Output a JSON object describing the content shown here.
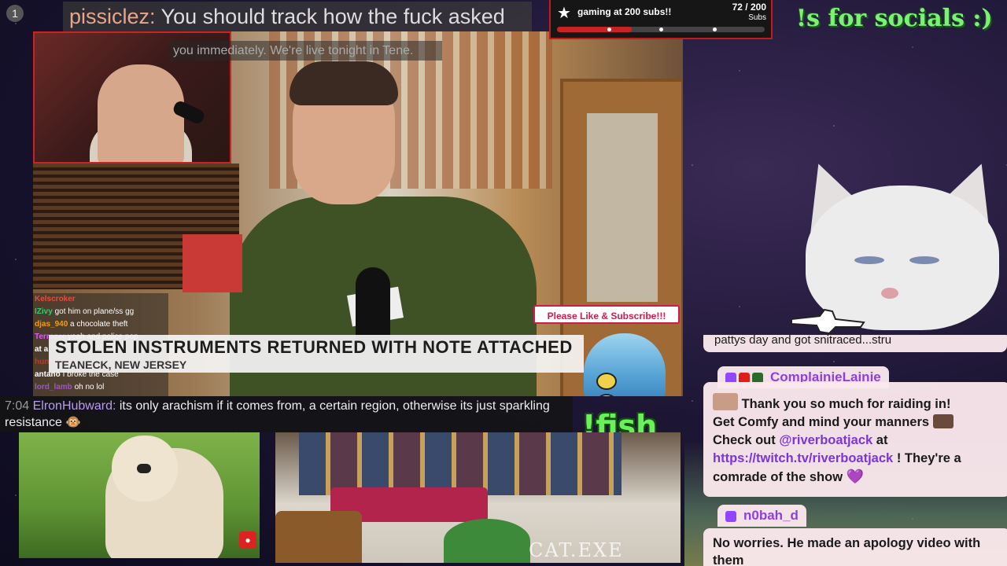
{
  "top_chat": {
    "badge": "1",
    "username": "pissiclez:",
    "message": "You should track how the fuck asked"
  },
  "sub_goal": {
    "icon": "star-icon",
    "title": "gaming at 200 subs!!",
    "count_text": "72 / 200",
    "label": "Subs",
    "progress": 0.36
  },
  "socials_text": "!s for socials :)",
  "main_video": {
    "captions": "you immediately. We're live tonight in Tene.",
    "headline": "STOLEN INSTRUMENTS RETURNED WITH NOTE ATTACHED",
    "location": "TEANECK, NEW JERSEY",
    "subscribe_label": "Please Like & Subscribe!!!"
  },
  "mini_chat": [
    {
      "user": "Kelscroker",
      "msg": "",
      "color": "#e74c3c"
    },
    {
      "user": "IZivy",
      "msg": "got him on plane/ss gg",
      "color": "#2ecc71"
    },
    {
      "user": "djas_940",
      "msg": "a chocolate theft",
      "color": "#f39c12"
    },
    {
      "user": "Terrozer",
      "msg": "yeah and police pop",
      "color": "#e056fd"
    },
    {
      "user": "at a",
      "msg": "",
      "color": "#ffffff"
    },
    {
      "user": "huntersbane",
      "msg": "",
      "color": "#c0392b"
    },
    {
      "user": "antano",
      "msg": "I broke the case",
      "color": "#ffffff"
    },
    {
      "user": "lord_lamb",
      "msg": "oh no lol",
      "color": "#9b59b6"
    }
  ],
  "bottom_chat": {
    "time": "7:04",
    "username": "ElronHubward:",
    "message": "its only arachism if it comes from, a certain region, otherwise its just sparkling resistance 🐵"
  },
  "fish_command": "!fish",
  "cat_cam_label": "CAT.EXE",
  "side_chat": {
    "prev_text": "pattys day and got snitraced...stru",
    "msg1": {
      "username": "ComplainieLainie",
      "text_a": "Thank you so much for raiding in!",
      "text_b": "Get Comfy and mind your manners",
      "text_c": "Check out",
      "mention": "@riverboatjack",
      "text_d": "at",
      "link": "https://twitch.tv/riverboatjack",
      "text_e": "! They're a comrade of the show",
      "heart": "💜"
    },
    "msg2": {
      "username": "n0bah_d",
      "text": "No worries. He made an apology video with them"
    }
  },
  "colors": {
    "accent_red": "#c41a1a",
    "chat_name": "#8e3fe0",
    "fish_green": "#6af05a"
  }
}
